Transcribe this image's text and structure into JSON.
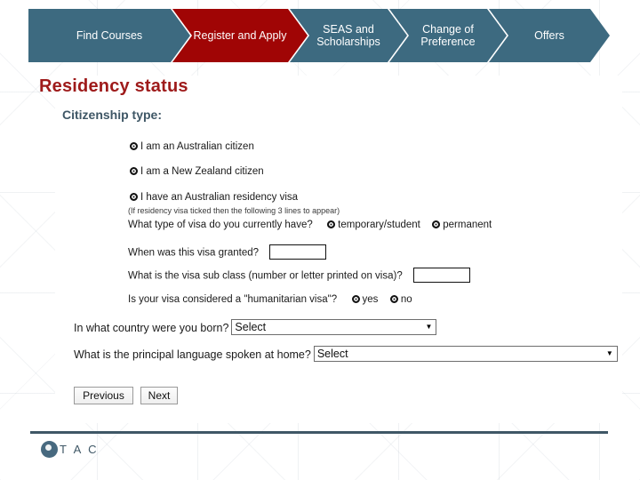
{
  "colors": {
    "chevron_blue": "#3d6a80",
    "chevron_active_red": "#a00505",
    "title_red": "#9e1a1a",
    "slate": "#3f5766"
  },
  "banner": {
    "steps": [
      {
        "label": "Find Courses",
        "state": "inactive"
      },
      {
        "label": "Register and Apply",
        "state": "active"
      },
      {
        "label": "SEAS and Scholarships",
        "state": "inactive"
      },
      {
        "label": "Change of Preference",
        "state": "inactive"
      },
      {
        "label": "Offers",
        "state": "inactive"
      }
    ]
  },
  "page": {
    "title": "Residency status",
    "subtitle": "Citizenship type:"
  },
  "citizenship": {
    "options": [
      {
        "label": "I am an Australian citizen"
      },
      {
        "label": "I am a New Zealand citizen"
      },
      {
        "label": "I have an Australian residency visa"
      }
    ],
    "note": "(If residency visa ticked then the following 3 lines to appear)"
  },
  "visa": {
    "type_question": "What type of visa do you currently have?",
    "type_options": [
      {
        "label": "temporary/student"
      },
      {
        "label": "permanent"
      }
    ],
    "granted_question": "When was this visa granted?",
    "granted_value": "",
    "subclass_question": "What is the visa sub class  (number or letter printed on visa)?",
    "subclass_value": "",
    "humanitarian_question": "Is your visa considered a \"humanitarian visa\"?",
    "humanitarian_options": [
      {
        "label": "yes"
      },
      {
        "label": "no"
      }
    ]
  },
  "country": {
    "question": "In what country were you born?",
    "selected": "Select"
  },
  "language": {
    "question": "What is the principal language spoken at home?",
    "selected": "Select"
  },
  "buttons": {
    "previous": "Previous",
    "next": "Next"
  },
  "footer": {
    "logo_text": "T A C"
  }
}
